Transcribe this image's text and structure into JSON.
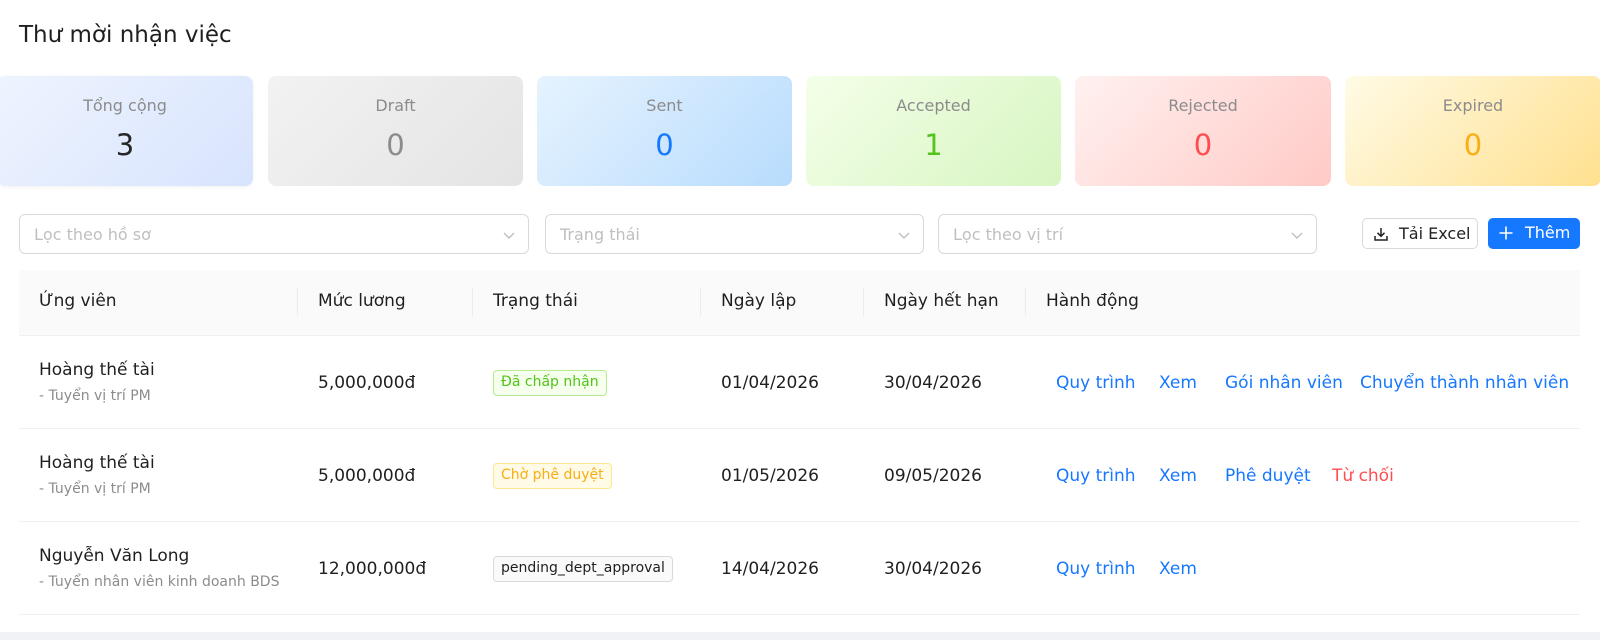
{
  "page": {
    "title": "Thư mời nhận việc"
  },
  "stats": [
    {
      "label": "Tổng cộng",
      "value": "3",
      "color": "#262626"
    },
    {
      "label": "Draft",
      "value": "0",
      "color": "#8c8c8c"
    },
    {
      "label": "Sent",
      "value": "0",
      "color": "#1677ff"
    },
    {
      "label": "Accepted",
      "value": "1",
      "color": "#52c41a"
    },
    {
      "label": "Rejected",
      "value": "0",
      "color": "#ff4d4f"
    },
    {
      "label": "Expired",
      "value": "0",
      "color": "#faad14"
    }
  ],
  "filters": {
    "profile": {
      "placeholder": "Lọc theo hồ sơ"
    },
    "status": {
      "placeholder": "Trạng thái"
    },
    "position": {
      "placeholder": "Lọc theo vị trí"
    }
  },
  "toolbar": {
    "export_label": "Tải Excel",
    "export_icon": "download-icon",
    "add_label": "Thêm",
    "add_icon": "plus-icon"
  },
  "table": {
    "columns": [
      "Ứng viên",
      "Mức lương",
      "Trạng thái",
      "Ngày lập",
      "Ngày hết hạn",
      "Hành động"
    ],
    "rows": [
      {
        "name": "Hoàng thế tài",
        "position": "- Tuyển vị trí PM",
        "salary": "5,000,000đ",
        "status": "Đã chấp nhận",
        "status_color": "#52c41a",
        "created": "01/04/2026",
        "expires": "30/04/2026",
        "actions": [
          "Quy trình",
          "Xem",
          "Gói nhân viên",
          "Chuyển thành nhân viên"
        ]
      },
      {
        "name": "Hoàng thế tài",
        "position": "- Tuyển vị trí PM",
        "salary": "5,000,000đ",
        "status": "Chờ phê duyệt",
        "status_color": "#faad14",
        "created": "01/05/2026",
        "expires": "09/05/2026",
        "actions": [
          "Quy trình",
          "Xem",
          "Phê duyệt",
          "Từ chối"
        ]
      },
      {
        "name": "Nguyễn Văn Long",
        "position": "- Tuyển nhân viên kinh doanh BDS",
        "salary": "12,000,000đ",
        "status": "pending_dept_approval",
        "status_color": "#1f1f1f",
        "created": "14/04/2026",
        "expires": "30/04/2026",
        "actions": [
          "Quy trình",
          "Xem"
        ]
      }
    ]
  }
}
